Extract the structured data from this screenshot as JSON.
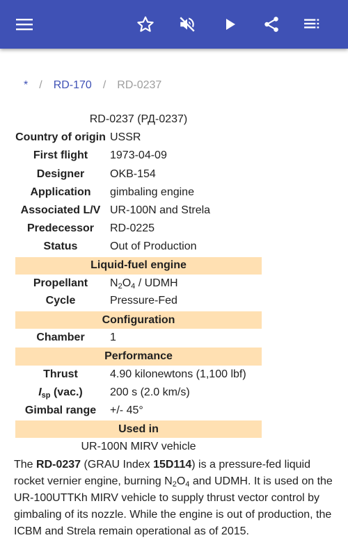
{
  "toolbar": {
    "menu_icon": "hamburger-menu-icon",
    "favorite_icon": "star-outline-icon",
    "mute_icon": "volume-off-icon",
    "play_icon": "play-icon",
    "share_icon": "share-icon",
    "toc_icon": "list-icon",
    "bar_color": "#3f51b5"
  },
  "breadcrumb": {
    "root": "*",
    "sep": "/",
    "parent": "RD-170",
    "current": "RD-0237"
  },
  "infobox": {
    "caption": "RD-0237 (РД-0237)",
    "country_label": "Country of origin",
    "country_value": "USSR",
    "first_flight_label": "First flight",
    "first_flight_value": "1973-04-09",
    "designer_label": "Designer",
    "designer_value": "OKB-154",
    "application_label": "Application",
    "application_value": "gimbaling engine",
    "associated_label": "Associated L/V",
    "associated_value": "UR-100N and Strela",
    "predecessor_label": "Predecessor",
    "predecessor_value": "RD-0225",
    "status_label": "Status",
    "status_value": "Out of Production",
    "section_liquid": "Liquid-fuel engine",
    "propellant_label": "Propellant",
    "propellant_n": "N",
    "propellant_sub1": "2",
    "propellant_o": "O",
    "propellant_sub2": "4",
    "propellant_rest": " / UDMH",
    "cycle_label": "Cycle",
    "cycle_value": "Pressure-Fed",
    "section_config": "Configuration",
    "chamber_label": "Chamber",
    "chamber_value": "1",
    "section_perf": "Performance",
    "thrust_label": "Thrust",
    "thrust_value": "4.90 kilonewtons (1,100 lbf)",
    "isp_i": "I",
    "isp_sub": "sp",
    "isp_rest": " (vac.)",
    "isp_value": "200 s (2.0 km/s)",
    "gimbal_label": "Gimbal range",
    "gimbal_value": "+/- 45°",
    "section_used": "Used in",
    "used_value": "UR-100N MIRV vehicle",
    "section_color": "#ffe0b2"
  },
  "article": {
    "t1": "The ",
    "b1": "RD-0237",
    "t2": " (GRAU Index ",
    "b2": "15D114",
    "t3": ") is a pressure-fed liquid rocket vernier engine, burning N",
    "s1": "2",
    "t4": "O",
    "s2": "4",
    "t5": " and UDMH. It is used on the UR-100UTTKh MIRV vehicle to supply thrust vector control by gimbaling of its nozzle. While the engine is out of production, the ICBM and Strela remain operational as of 2015."
  }
}
